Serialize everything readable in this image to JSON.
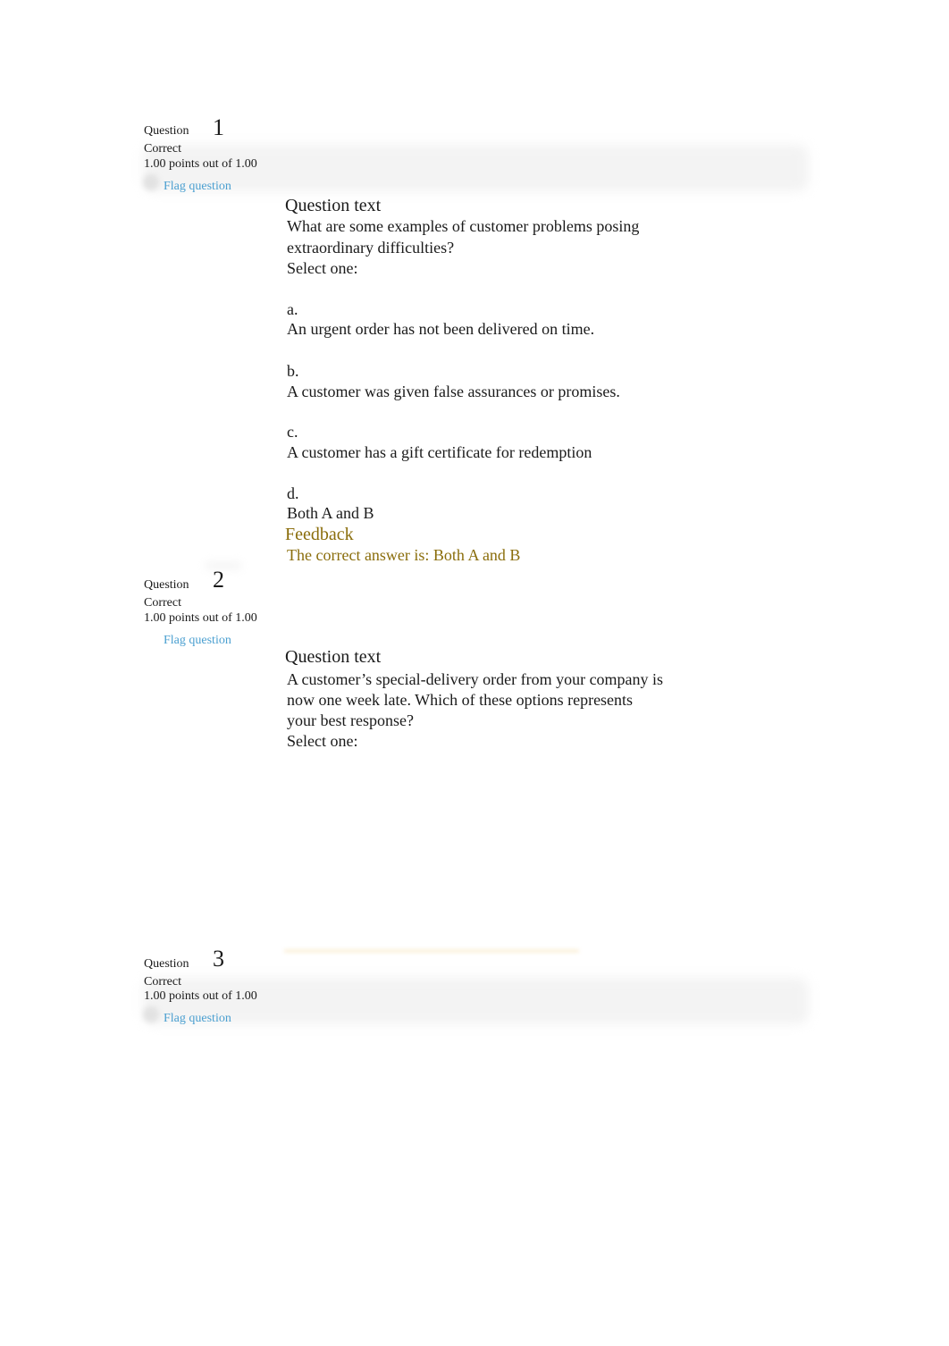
{
  "questions": [
    {
      "label": "Question",
      "number": "1",
      "state": "Correct",
      "grade": "1.00 points out of 1.00",
      "flag_label": "Flag question",
      "question_text_heading": "Question text",
      "prompt_lines": [
        "What are some examples of customer problems posing",
        "extraordinary difficulties?"
      ],
      "select_label": "Select one:",
      "options": [
        {
          "letter": "a.",
          "text": "An urgent order has not been delivered on time."
        },
        {
          "letter": "b.",
          "text": "A customer was given false assurances or promises."
        },
        {
          "letter": "c.",
          "text": "A customer has a gift certificate for redemption"
        },
        {
          "letter": "d.",
          "text": "Both A and B"
        }
      ],
      "feedback_heading": "Feedback",
      "feedback_text": "The correct answer is: Both A and B"
    },
    {
      "label": "Question",
      "number": "2",
      "state": "Correct",
      "grade": "1.00 points out of 1.00",
      "flag_label": "Flag question",
      "question_text_heading": "Question text",
      "prompt_lines": [
        "A customer’s special-delivery order from your company is",
        "now one week late. Which of these options represents",
        "your best response?"
      ],
      "select_label": "Select one:"
    },
    {
      "label": "Question",
      "number": "3",
      "state": "Correct",
      "grade": "1.00 points out of 1.00",
      "flag_label": "Flag question"
    }
  ],
  "colors": {
    "link": "#4a9fd0",
    "feedback": "#8a6d0b",
    "text": "#1a1a1a"
  }
}
